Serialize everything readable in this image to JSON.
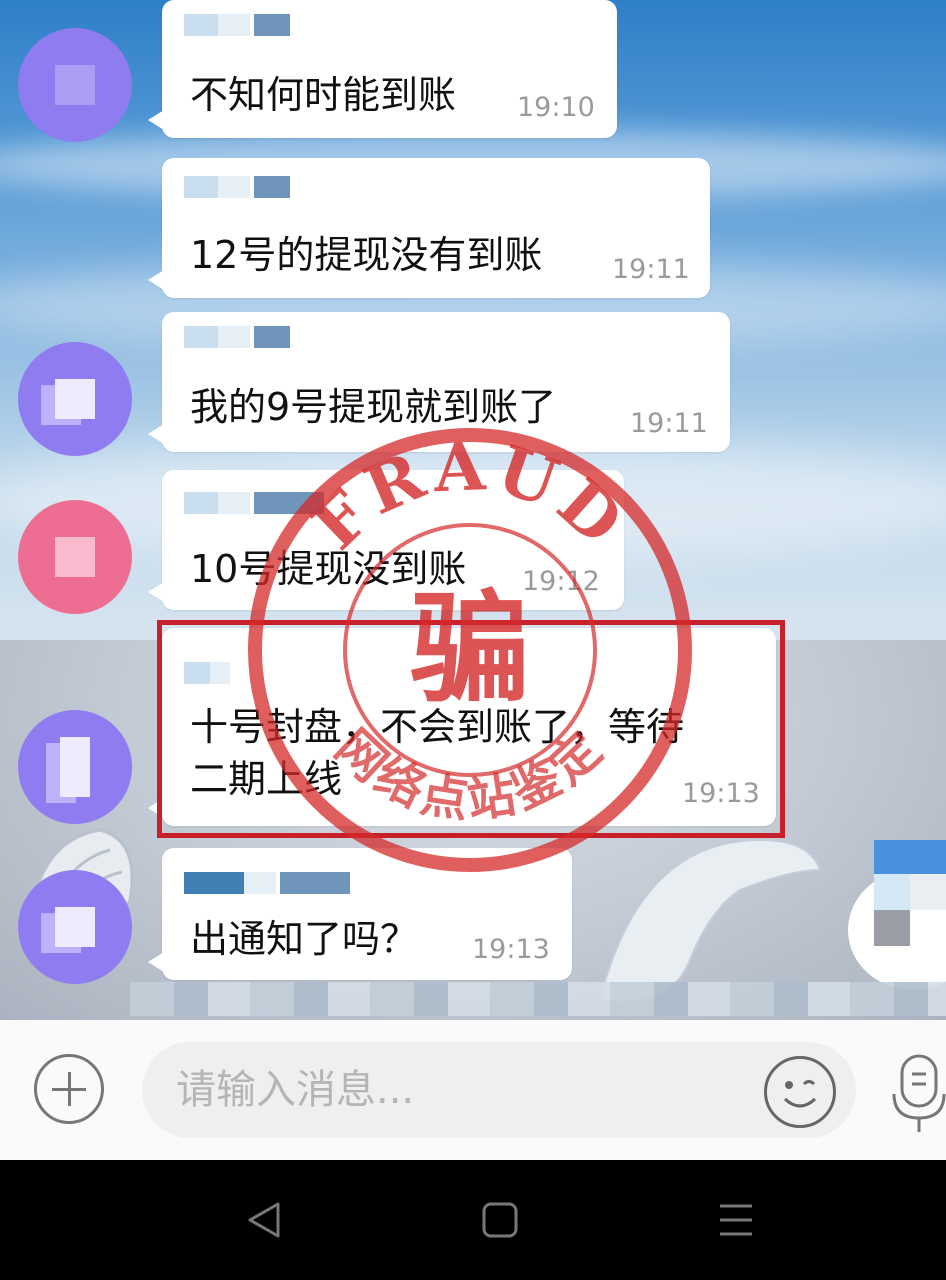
{
  "messages": [
    {
      "text": "不知何时能到账",
      "time": "19:10"
    },
    {
      "text": "12号的提现没有到账",
      "time": "19:11"
    },
    {
      "text": "我的9号提现就到账了",
      "time": "19:11"
    },
    {
      "text": "10号提现没到账",
      "time": "19:12"
    },
    {
      "text_line1": "十号封盘，不会到账了，等待",
      "text_line2": "二期上线",
      "time": "19:13",
      "highlighted": true
    },
    {
      "text": "出通知了吗？",
      "time": "19:13"
    }
  ],
  "input": {
    "placeholder": "请输入消息..."
  },
  "stamp": {
    "top_text": "FRAUD",
    "center_char": "骗",
    "bottom_text": "网络点站鉴定"
  },
  "colors": {
    "avatar_purple": "#8f7cf0",
    "avatar_pink": "#ee6d93",
    "stamp_red": "#d42a2a",
    "highlight_border": "#c8202a"
  },
  "icons": [
    "plus-icon",
    "emoji-icon",
    "microphone-icon",
    "nav-back-icon",
    "nav-home-icon",
    "nav-menu-icon"
  ]
}
